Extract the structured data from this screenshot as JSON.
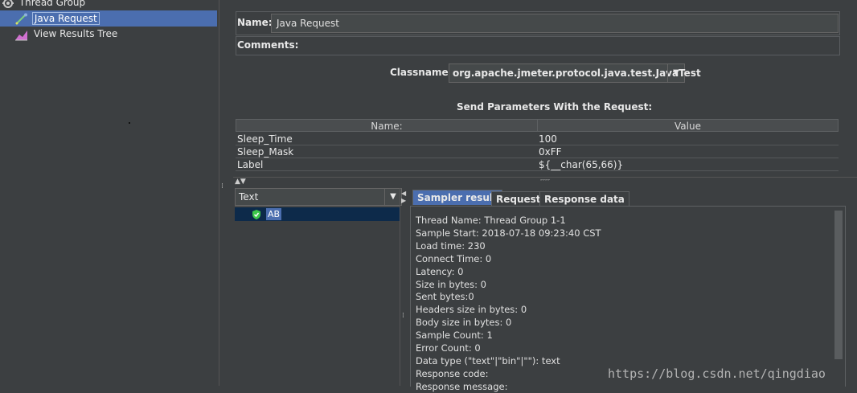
{
  "tree": {
    "items": [
      {
        "label": "Thread Group",
        "icon": "gear-icon"
      },
      {
        "label": "Java Request",
        "icon": "pipette-icon",
        "selected": true
      },
      {
        "label": "View Results Tree",
        "icon": "chart-icon"
      }
    ]
  },
  "config": {
    "name_label": "Name:",
    "name_value": "Java Request",
    "comments_label": "Comments:",
    "classname_label": "Classname:",
    "classname_value": "org.apache.jmeter.protocol.java.test.JavaTest",
    "params_title": "Send Parameters With the Request:",
    "params_headers": [
      "Name:",
      "Value"
    ],
    "params_rows": [
      {
        "name": "Sleep_Time",
        "value": "100"
      },
      {
        "name": "Sleep_Mask",
        "value": "0xFF"
      },
      {
        "name": "Label",
        "value": "${__char(65,66)}"
      }
    ]
  },
  "results": {
    "renderer_value": "Text",
    "result_label": "AB",
    "tabs": [
      "Sampler result",
      "Request",
      "Response data"
    ],
    "active_tab": 0,
    "lines": [
      "Thread Name: Thread Group 1-1",
      "Sample Start: 2018-07-18 09:23:40 CST",
      "Load time: 230",
      "Connect Time: 0",
      "Latency: 0",
      "Size in bytes: 0",
      "Sent bytes:0",
      "Headers size in bytes: 0",
      "Body size in bytes: 0",
      "Sample Count: 1",
      "Error Count: 0",
      "Data type (\"text\"|\"bin\"|\"\"): text",
      "Response code:",
      "Response message:"
    ]
  },
  "watermark": "https://blog.csdn.net/qingdiao",
  "colors": {
    "background": "#3c3f41",
    "selection": "#4b6eaf",
    "success": "#3cc84a"
  }
}
